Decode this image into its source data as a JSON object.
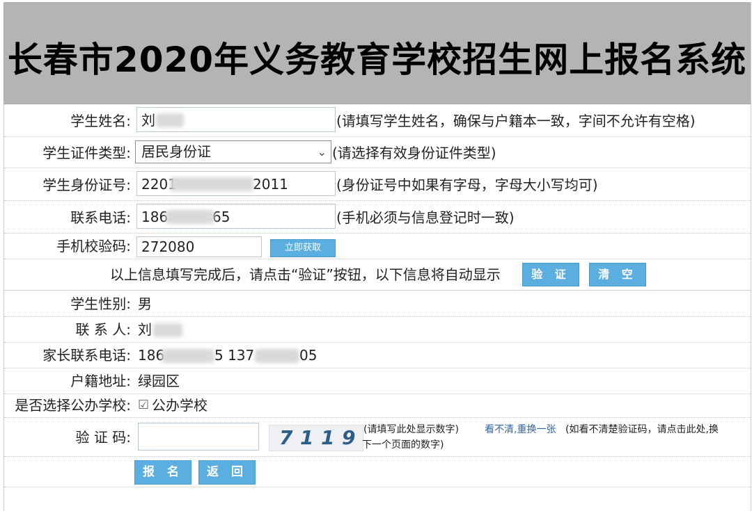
{
  "header": {
    "title": "长春市2020年义务教育学校招生网上报名系统"
  },
  "form": {
    "student_name": {
      "label": "学生姓名:",
      "value": "刘",
      "hint": "(请填写学生姓名，确保与户籍本一致，字间不允许有空格)"
    },
    "id_type": {
      "label": "学生证件类型:",
      "value": "居民身份证",
      "hint": "(请选择有效身份证件类型)"
    },
    "id_number": {
      "label": "学生身份证号:",
      "value_start": "2201",
      "value_end": "2011",
      "hint": "(身份证号中如果有字母，字母大小写均可)"
    },
    "phone": {
      "label": "联系电话:",
      "value_start": "186",
      "value_end": "65",
      "hint": "(手机必须与信息登记时一致)"
    },
    "sms_code": {
      "label": "手机校验码:",
      "value": "272080",
      "button": "立即获取"
    },
    "verify_row": {
      "text": "以上信息填写完成后，请点击“验证”按钮，以下信息将自动显示",
      "verify_button": "验 证",
      "clear_button": "清 空"
    }
  },
  "info": {
    "gender": {
      "label": "学生性别:",
      "value": "男"
    },
    "contact": {
      "label": "联 系 人:",
      "value": "刘"
    },
    "parent_phone": {
      "label": "家长联系电话:",
      "v1": "186",
      "v2": "5 137",
      "v3": "05"
    },
    "address": {
      "label": "户籍地址:",
      "value": "绿园区"
    },
    "public_school": {
      "label": "是否选择公办学校:",
      "check": "☑",
      "value": "公办学校"
    }
  },
  "captcha": {
    "label": "验 证 码:",
    "digits": [
      "7",
      "1",
      "1",
      "9"
    ],
    "hint1": "(请填写此处显示数字)",
    "link": "看不清,重换一张",
    "hint2a": "(如看不清楚验证码，请点击此处,换",
    "hint2b": "下一个页面的数字)"
  },
  "actions": {
    "submit": "报 名",
    "back": "返 回"
  }
}
